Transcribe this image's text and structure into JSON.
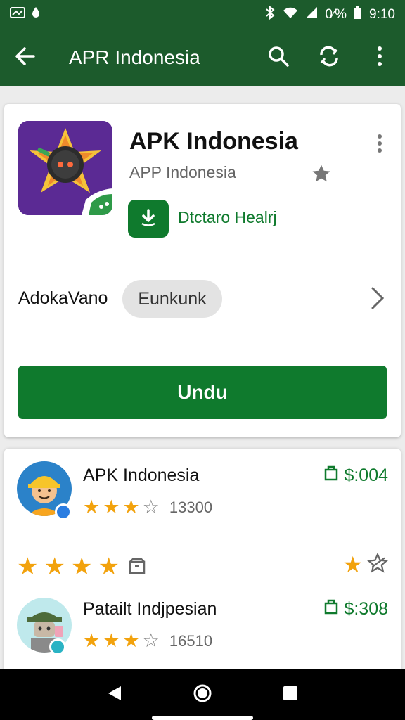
{
  "status": {
    "battery_percent": "0⁄%",
    "time": "9:10",
    "icons": [
      "notification-icon",
      "app-icon",
      "bluetooth-icon",
      "wifi-icon",
      "signal-icon",
      "battery-icon"
    ]
  },
  "appbar": {
    "title": "APR Indonesia",
    "icons": [
      "back-arrow-icon",
      "search-icon",
      "sync-icon",
      "more-vert-icon"
    ],
    "color": "#1c5b2c"
  },
  "app": {
    "title": "APK Indonesia",
    "developer": "APP Indonesia",
    "installed_label": "Dtctaro Healrj",
    "category": "AdokaVano",
    "chip": "Eunkunk",
    "primary_button": "Undu",
    "accent_color": "#0f7a2d"
  },
  "related": {
    "items": [
      {
        "title": "APK Indonesia",
        "rating": 3.5,
        "count": "13300",
        "price": "$:004"
      },
      {
        "title": "Patailt Indjpesian",
        "rating": 3.5,
        "count": "16510",
        "price": "$:308"
      }
    ],
    "featured_rating": 4
  },
  "nav": {
    "icons": [
      "nav-back-icon",
      "nav-home-icon",
      "nav-recents-icon"
    ]
  }
}
